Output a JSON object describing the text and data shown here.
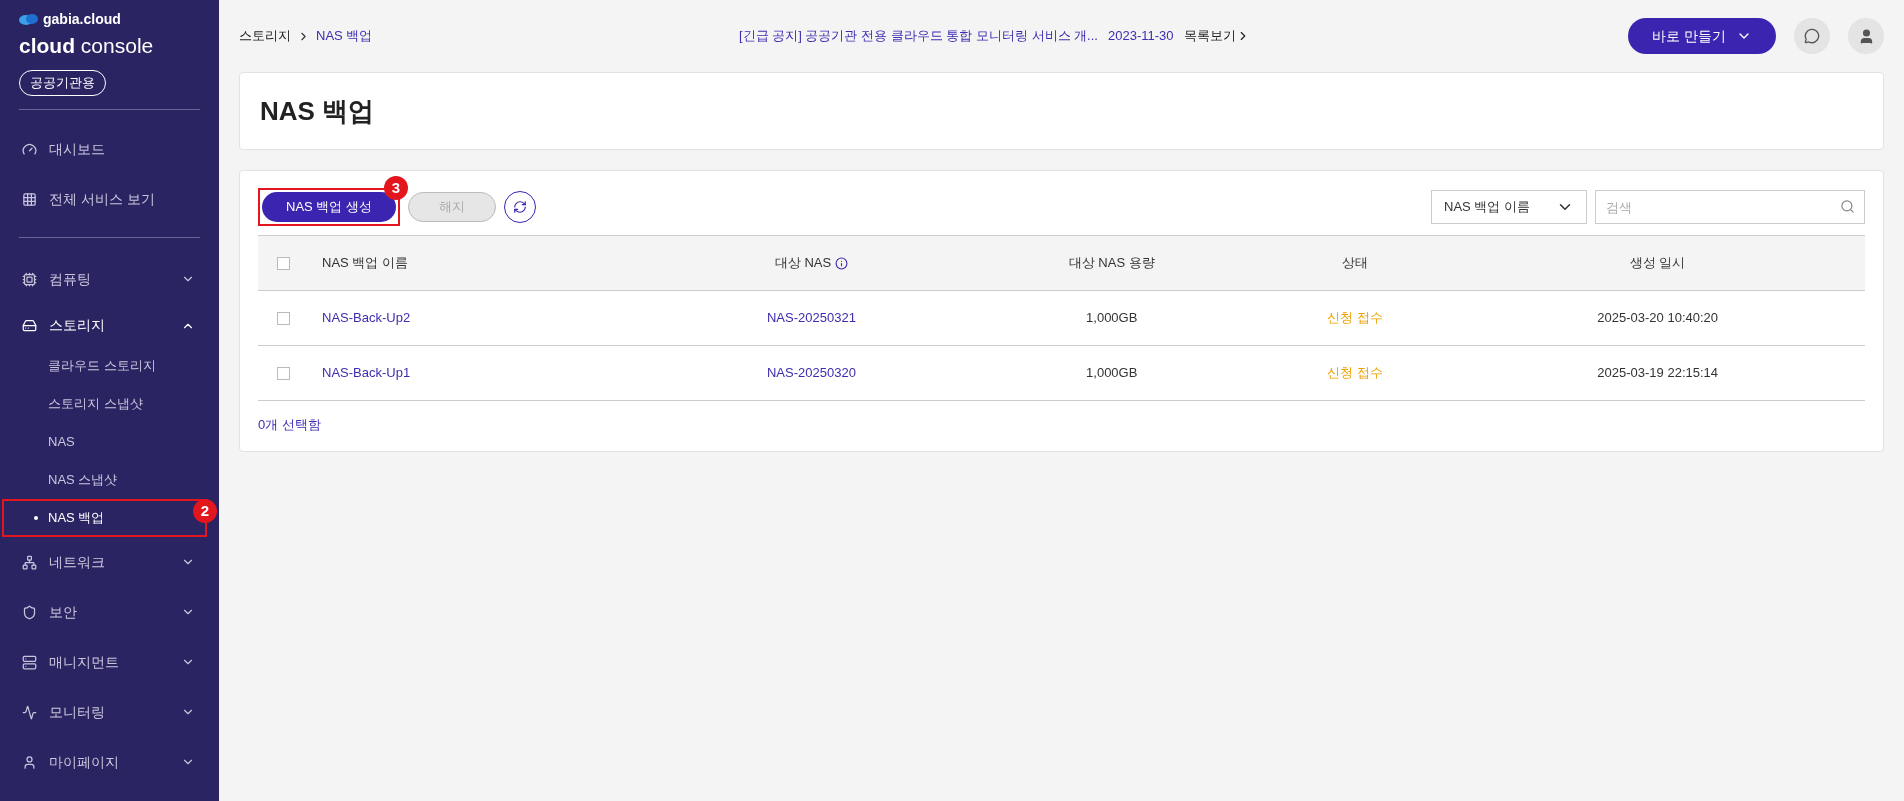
{
  "sidebar": {
    "brand": "gabia.cloud",
    "product_bold": "cloud",
    "product": "console",
    "badge": "공공기관용",
    "sections": [
      [
        {
          "kind": "link",
          "label": "대시보드"
        },
        {
          "kind": "link",
          "label": "전체 서비스 보기"
        }
      ],
      [
        {
          "kind": "group",
          "label": "컴퓨팅",
          "expanded": false
        },
        {
          "kind": "group",
          "label": "스토리지",
          "expanded": true,
          "children": [
            {
              "label": "클라우드 스토리지",
              "selected": false
            },
            {
              "label": "스토리지 스냅샷",
              "selected": false
            },
            {
              "label": "NAS",
              "selected": false
            },
            {
              "label": "NAS 스냅샷",
              "selected": false
            },
            {
              "label": "NAS 백업",
              "selected": true,
              "annotation": "2"
            }
          ]
        },
        {
          "kind": "group",
          "label": "네트워크",
          "expanded": false
        },
        {
          "kind": "group",
          "label": "보안",
          "expanded": false
        },
        {
          "kind": "group",
          "label": "매니지먼트",
          "expanded": false
        },
        {
          "kind": "group",
          "label": "모니터링",
          "expanded": false
        },
        {
          "kind": "group",
          "label": "마이페이지",
          "expanded": false
        }
      ]
    ]
  },
  "header": {
    "breadcrumb": [
      "스토리지",
      "NAS 백업"
    ],
    "notice": "[긴급 공지] 공공기관 전용 클라우드 통합 모니터링 서비스 개...",
    "notice_date": "2023-11-30",
    "notice_link": "목록보기",
    "create_button": "바로 만들기"
  },
  "page_title": "NAS 백업",
  "toolbar": {
    "buttons": [
      {
        "kind": "primary",
        "label": "NAS 백업 생성",
        "disabled": false,
        "annotation": "3"
      },
      {
        "kind": "secondary",
        "label": "해지",
        "disabled": true
      }
    ],
    "filter": "NAS 백업 이름",
    "search_placeholder": "검색"
  },
  "table": {
    "select_all_checked": false,
    "columns": [
      {
        "label": "NAS 백업 이름",
        "info": false
      },
      {
        "label": "대상 NAS",
        "info": true
      },
      {
        "label": "대상 NAS 용량",
        "info": false
      },
      {
        "label": "상태",
        "info": false
      },
      {
        "label": "생성 일시",
        "info": false
      }
    ],
    "rows": [
      {
        "checked": false,
        "name": "NAS-Back-Up2",
        "target": "NAS-20250321",
        "capacity": "1,000GB",
        "status": "신청 접수",
        "created": "2025-03-20 10:40:20"
      },
      {
        "checked": false,
        "name": "NAS-Back-Up1",
        "target": "NAS-20250320",
        "capacity": "1,000GB",
        "status": "신청 접수",
        "created": "2025-03-19 22:15:14"
      }
    ],
    "selection_summary": "0개 선택함"
  }
}
